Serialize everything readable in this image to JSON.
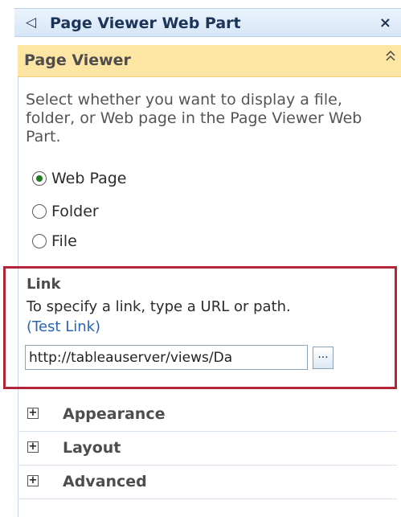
{
  "header": {
    "collapse_icon": "collapse-left-arrow-icon",
    "title": "Page Viewer Web Part",
    "close_icon": "close-icon",
    "close_glyph": "×"
  },
  "section": {
    "title": "Page Viewer",
    "collapse_icon": "double-chevron-up-icon",
    "description": "Select whether you want to display a file, folder, or Web page in the Page Viewer Web Part."
  },
  "options": [
    {
      "label": "Web Page",
      "checked": true
    },
    {
      "label": "Folder",
      "checked": false
    },
    {
      "label": "File",
      "checked": false
    }
  ],
  "link": {
    "title": "Link",
    "description": "To specify a link, type a URL or path.",
    "test_link_label": "(Test Link)",
    "url_value": "http://tableauserver/views/Da",
    "browse_label": "..."
  },
  "collapsed_sections": [
    {
      "label": "Appearance"
    },
    {
      "label": "Layout"
    },
    {
      "label": "Advanced"
    }
  ],
  "colors": {
    "header_bg": "#d7e6f7",
    "section_header_bg": "#fde6a4",
    "highlight_border": "#b3263a",
    "link_color": "#2a64b7"
  }
}
